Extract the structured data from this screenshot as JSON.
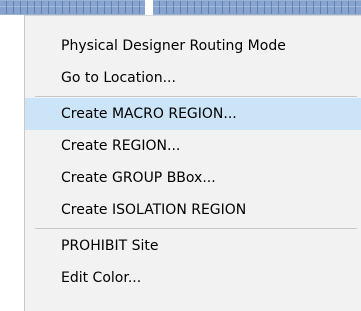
{
  "menu": {
    "items": [
      {
        "label": "Physical Designer Routing Mode"
      },
      {
        "label": "Go to Location..."
      },
      {
        "label": "Create MACRO REGION..."
      },
      {
        "label": "Create REGION..."
      },
      {
        "label": "Create GROUP BBox..."
      },
      {
        "label": "Create ISOLATION REGION"
      },
      {
        "label": "PROHIBIT Site"
      },
      {
        "label": "Edit Color..."
      }
    ],
    "highlighted_item": "Create MACRO REGION..."
  },
  "colors": {
    "menu_background": "#f2f2f2",
    "highlight": "#cce4f7",
    "separator": "#c8c8c8",
    "text": "#000000"
  }
}
